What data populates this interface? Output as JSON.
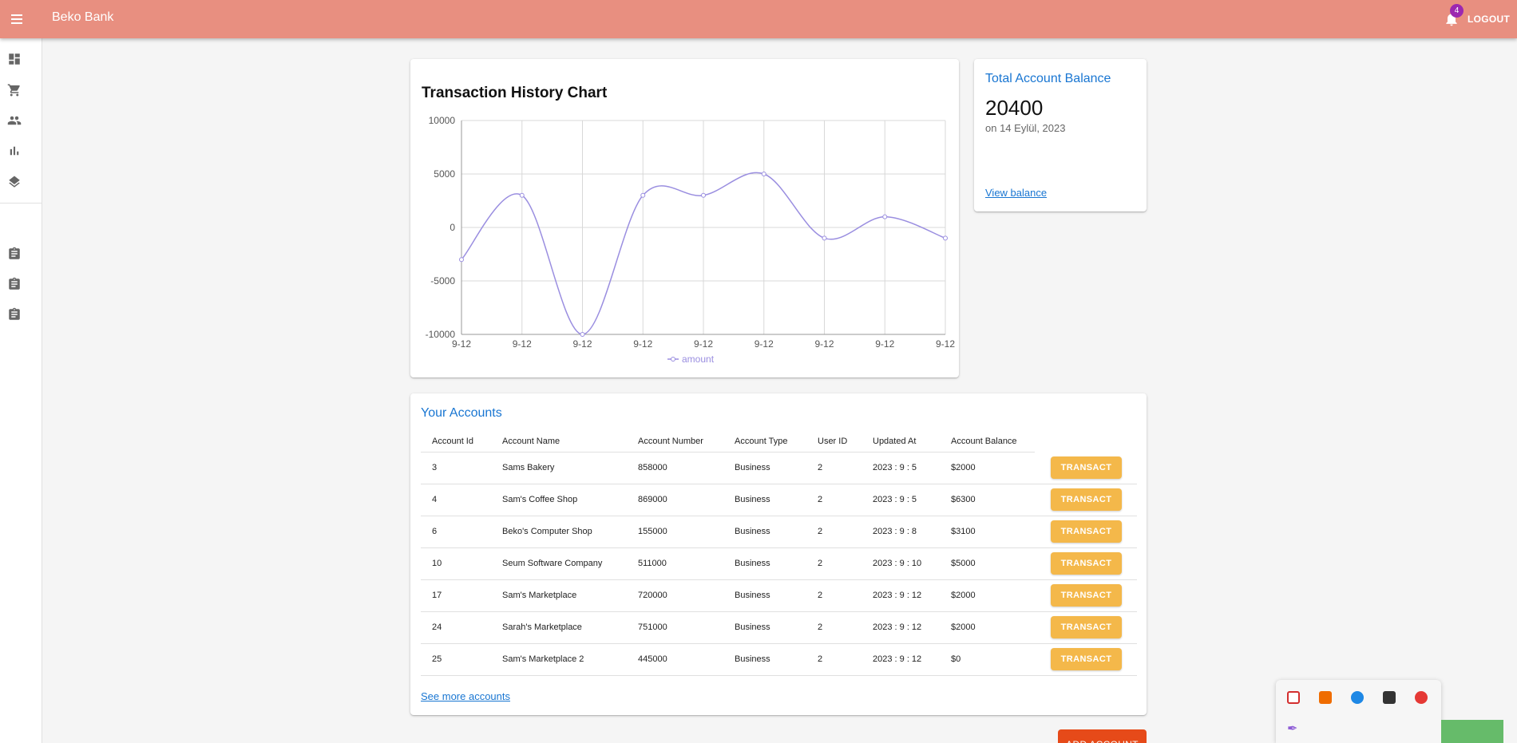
{
  "app": {
    "title": "Beko Bank",
    "notification_count": "4",
    "logout_label": "LOGOUT"
  },
  "sidebar": {
    "items": [
      {
        "icon": "dashboard-icon"
      },
      {
        "icon": "shopping-cart-icon"
      },
      {
        "icon": "people-icon"
      },
      {
        "icon": "bar-chart-icon"
      },
      {
        "icon": "layers-icon"
      },
      {
        "icon": "assignment-icon"
      },
      {
        "icon": "assignment-icon"
      },
      {
        "icon": "assignment-icon"
      }
    ]
  },
  "chart_data": {
    "type": "line",
    "title": "Transaction History Chart",
    "categories": [
      "9-12",
      "9-12",
      "9-12",
      "9-12",
      "9-12",
      "9-12",
      "9-12",
      "9-12",
      "9-12"
    ],
    "series": [
      {
        "name": "amount",
        "values": [
          -3000,
          3000,
          -10000,
          3000,
          3000,
          5000,
          -1000,
          1000,
          -1000
        ]
      }
    ],
    "yticks": [
      "10000",
      "5000",
      "0",
      "-5000",
      "-10000"
    ],
    "ylim": [
      -10000,
      10000
    ],
    "grid": true,
    "legend": "bottom",
    "line_color": "#9a8ee0"
  },
  "balance": {
    "title": "Total Account Balance",
    "value": "20400",
    "date": "on 14 Eylül, 2023",
    "link": "View balance"
  },
  "accounts": {
    "title": "Your Accounts",
    "columns": [
      "Account Id",
      "Account Name",
      "Account Number",
      "Account Type",
      "User ID",
      "Updated At",
      "Account Balance"
    ],
    "rows": [
      {
        "id": "3",
        "name": "Sams Bakery",
        "number": "858000",
        "type": "Business",
        "user_id": "2",
        "updated": "2023 : 9 : 5",
        "balance": "$2000",
        "action": "TRANSACT"
      },
      {
        "id": "4",
        "name": "Sam's Coffee Shop",
        "number": "869000",
        "type": "Business",
        "user_id": "2",
        "updated": "2023 : 9 : 5",
        "balance": "$6300",
        "action": "TRANSACT"
      },
      {
        "id": "6",
        "name": "Beko's Computer Shop",
        "number": "155000",
        "type": "Business",
        "user_id": "2",
        "updated": "2023 : 9 : 8",
        "balance": "$3100",
        "action": "TRANSACT"
      },
      {
        "id": "10",
        "name": "Seum Software Company",
        "number": "511000",
        "type": "Business",
        "user_id": "2",
        "updated": "2023 : 9 : 10",
        "balance": "$5000",
        "action": "TRANSACT"
      },
      {
        "id": "17",
        "name": "Sam's Marketplace",
        "number": "720000",
        "type": "Business",
        "user_id": "2",
        "updated": "2023 : 9 : 12",
        "balance": "$2000",
        "action": "TRANSACT"
      },
      {
        "id": "24",
        "name": "Sarah's Marketplace",
        "number": "751000",
        "type": "Business",
        "user_id": "2",
        "updated": "2023 : 9 : 12",
        "balance": "$2000",
        "action": "TRANSACT"
      },
      {
        "id": "25",
        "name": "Sam's Marketplace 2",
        "number": "445000",
        "type": "Business",
        "user_id": "2",
        "updated": "2023 : 9 : 12",
        "balance": "$0",
        "action": "TRANSACT"
      }
    ],
    "more_link": "See more accounts"
  },
  "add_account_label": "ADD ACCOUNT",
  "colors": {
    "appbar": "#e88f80",
    "accent": "#1976d2",
    "transact": "#f4b84a",
    "add_account": "#e64a19"
  }
}
